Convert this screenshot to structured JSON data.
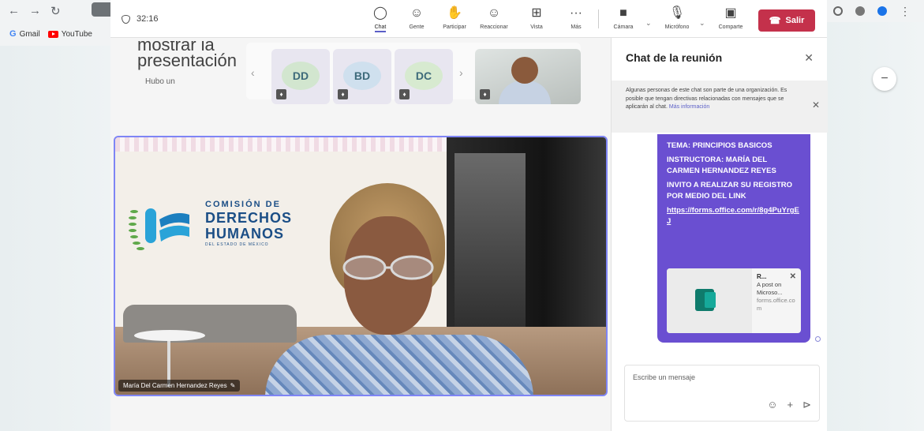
{
  "toolbar": {
    "timer": "32:16",
    "chat": "Chat",
    "people": "Gente",
    "raise": "Participar",
    "react": "Reaccionar",
    "view": "Vista",
    "more": "Más",
    "camera": "Cámara",
    "mic": "Micrófono",
    "share": "Comparte",
    "leave": "Salir"
  },
  "bookmarks": {
    "gmail": "Gmail",
    "youtube": "YouTube"
  },
  "presentation": {
    "title_line1": "mostrar la",
    "title_line2": "presentación",
    "subtitle": "Hubo un"
  },
  "participants": [
    {
      "initials": "DD",
      "color": "#d2e6cf"
    },
    {
      "initials": "BD",
      "color": "#cfe0ee"
    },
    {
      "initials": "DC",
      "color": "#d7ead0"
    }
  ],
  "stage": {
    "speaker_name": "María Del Carmen Hernandez Reyes",
    "logo": {
      "line1": "COMISIÓN DE",
      "line2": "DERECHOS",
      "line3": "HUMANOS",
      "line4": "DEL ESTADO DE MÉXICO"
    }
  },
  "chat": {
    "title": "Chat de la reunión",
    "notice": "Algunas personas de este chat son parte de una organización. Es posible que tengan directivas relacionadas con mensajes que se aplicarán al chat.",
    "notice_link": "Más información",
    "message": {
      "topic": "TEMA: PRINCIPIOS BASICOS",
      "instructor": "INSTRUCTORA: MARÍA DEL CARMEN HERNANDEZ REYES",
      "invite": "INVITO A REALIZAR SU REGISTRO POR MEDIO DEL LINK",
      "link": "https://forms.office.com/r/8g4PuYrgEJ"
    },
    "card": {
      "title": "R...",
      "description": "A post on Microso...",
      "domain": "forms.office.com"
    },
    "compose_placeholder": "Escribe un mensaje"
  },
  "colors": {
    "accent": "#5b5fc7",
    "leave": "#c4314b",
    "bubble": "#6a4fd1"
  },
  "icons": [
    "chat-icon",
    "people-icon",
    "hand-icon",
    "emoji-icon",
    "grid-icon",
    "more-icon",
    "camera-icon",
    "mic-off-icon",
    "share-icon",
    "phone-icon"
  ]
}
